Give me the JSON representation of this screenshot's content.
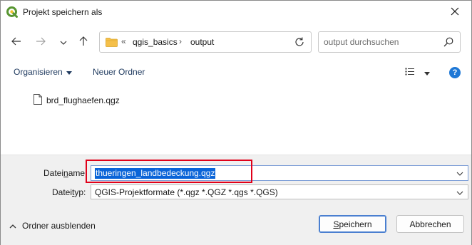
{
  "window": {
    "title": "Projekt speichern als"
  },
  "navigation": {
    "path_prefix": "«",
    "breadcrumbs": [
      "qgis_basics",
      "output"
    ],
    "separator": "›",
    "search_placeholder": "output durchsuchen"
  },
  "commandbar": {
    "organize_label": "Organisieren",
    "new_folder_label": "Neuer Ordner",
    "help_label": "?"
  },
  "files": [
    {
      "name": "brd_flughaefen.qgz"
    }
  ],
  "form": {
    "filename_label_pre": "Datei",
    "filename_label_u": "n",
    "filename_label_post": "ame:",
    "filename_value": "thueringen_landbedeckung.qgz",
    "filetype_label_pre": "Datei",
    "filetype_label_u": "t",
    "filetype_label_post": "yp:",
    "filetype_value": "QGIS-Projektformate (*.qgz *.QGZ *.qgs *.QGS)"
  },
  "footer": {
    "hide_folders_label": "Ordner ausblenden",
    "save_label_u": "S",
    "save_label_rest": "peichern",
    "cancel_label": "Abbrechen"
  },
  "colors": {
    "accent": "#0a64d8",
    "highlight_annotation": "#e0001a",
    "help_icon": "#1e78d6",
    "qgis_green": "#589632",
    "qgis_yellow": "#f0c22e"
  }
}
